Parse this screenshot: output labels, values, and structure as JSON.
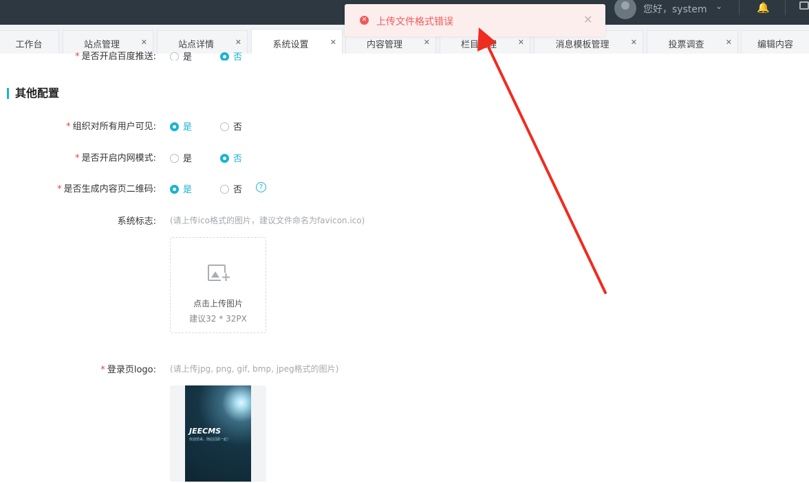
{
  "header": {
    "greeting": "您好，system"
  },
  "tabs": [
    {
      "label": "工作台",
      "closable": false
    },
    {
      "label": "站点管理",
      "closable": true
    },
    {
      "label": "站点详情",
      "closable": true
    },
    {
      "label": "系统设置",
      "closable": true,
      "active": true
    },
    {
      "label": "内容管理",
      "closable": true
    },
    {
      "label": "栏目管理",
      "closable": true
    },
    {
      "label": "消息模板管理",
      "closable": true
    },
    {
      "label": "投票调查",
      "closable": true
    },
    {
      "label": "编辑内容",
      "closable": false
    }
  ],
  "form": {
    "baidu_push_label": "是否开启百度推送:",
    "section_title": "其他配置",
    "org_visible_label": "组织对所有用户可见:",
    "intranet_label": "是否开启内网模式:",
    "qrcode_label": "是否生成内容页二维码:",
    "yes": "是",
    "no": "否",
    "help_symbol": "?",
    "favicon_label": "系统标志:",
    "favicon_hint": "(请上传ico格式的图片，建议文件命名为favicon.ico)",
    "upload_text": "点击上传图片",
    "upload_size": "建议32 * 32PX",
    "login_logo_label": "登录页logo:",
    "login_logo_hint": "(请上传jpg, png, gif, bmp, jpeg格式的图片)",
    "logo_brand": "JEECMS",
    "logo_tagline": "欢迎您来，随后回顾一起！"
  },
  "toast": {
    "message": "上传文件格式错误",
    "type": "error"
  },
  "colors": {
    "accent": "#1ab3d3",
    "error": "#f05a5a",
    "annotation_arrow": "#f02b1f"
  }
}
